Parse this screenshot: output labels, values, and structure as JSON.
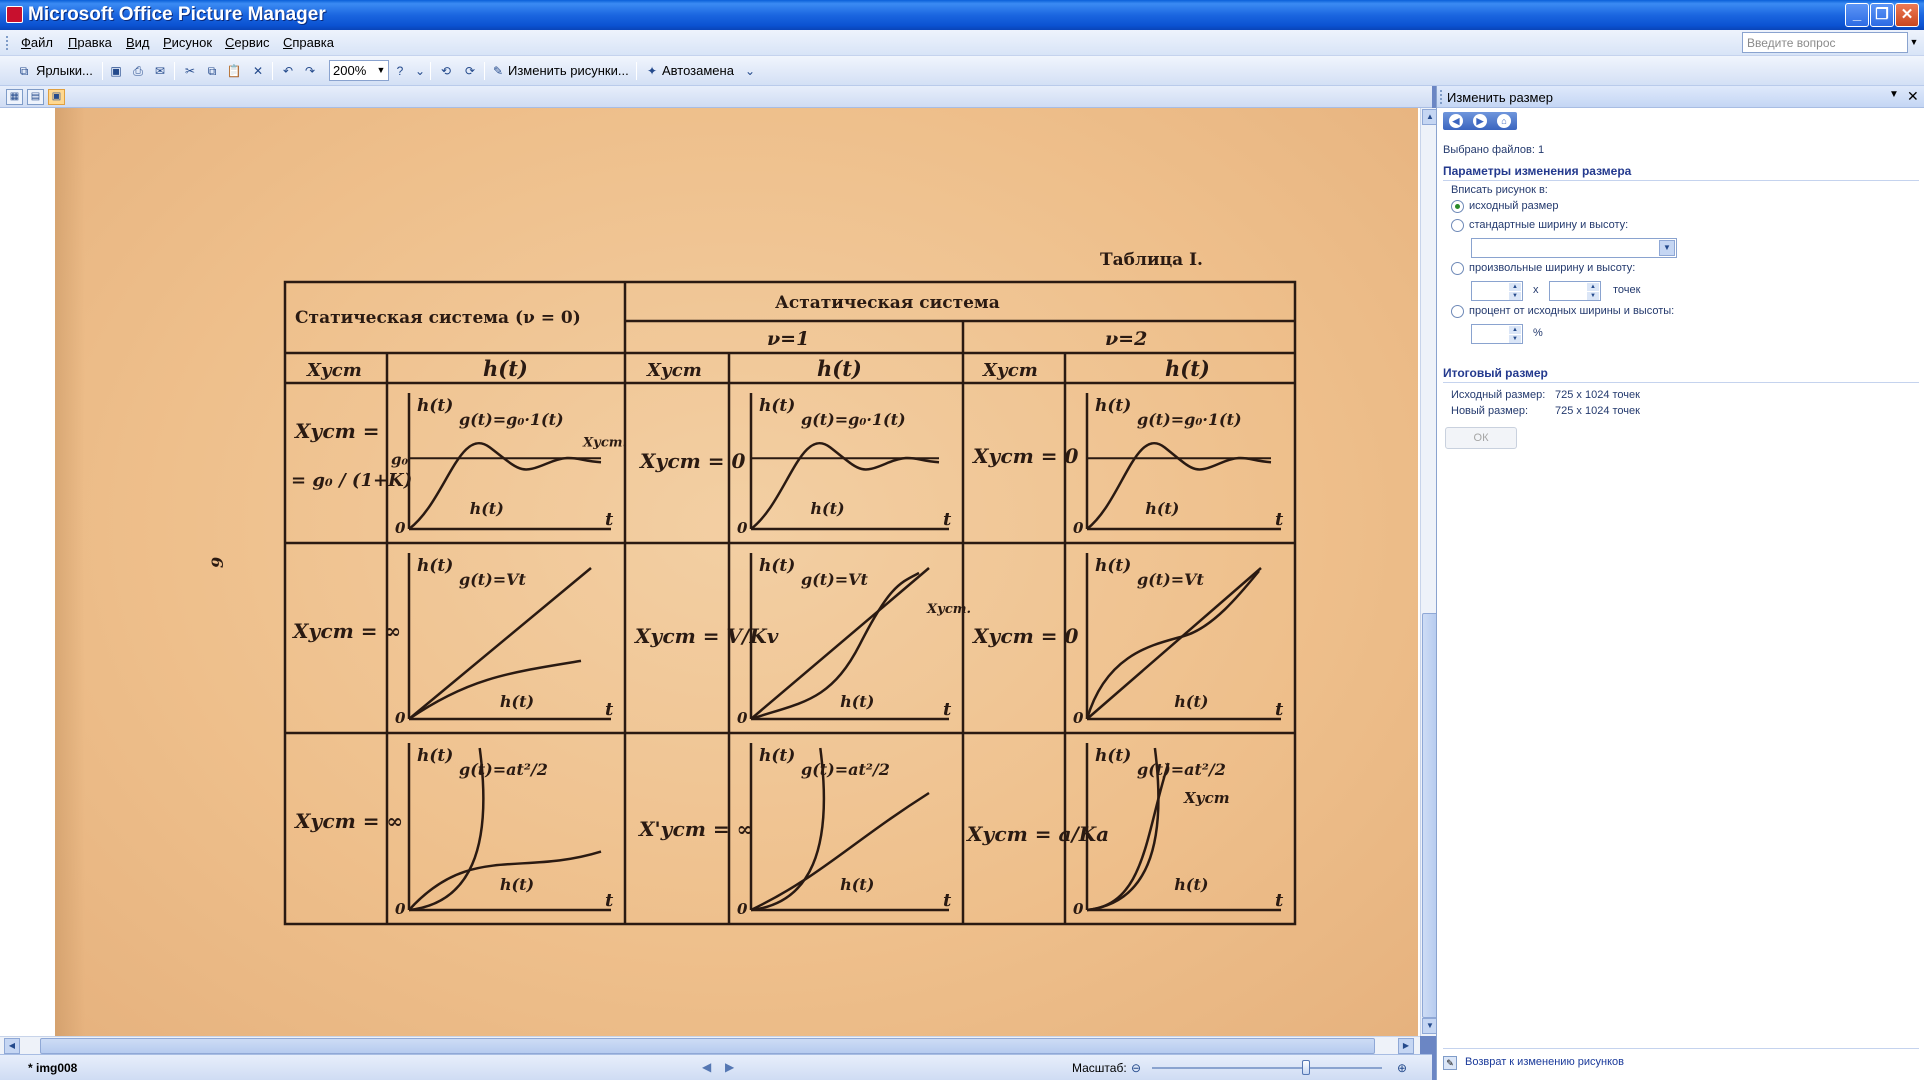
{
  "window": {
    "title": "Microsoft Office Picture Manager"
  },
  "menu": [
    "Файл",
    "Правка",
    "Вид",
    "Рисунок",
    "Сервис",
    "Справка"
  ],
  "ask_placeholder": "Введите вопрос",
  "toolbar": {
    "shortcuts": "Ярлыки...",
    "zoom": "200%",
    "edit_pictures": "Изменить рисунки...",
    "autocorrect": "Автозамена"
  },
  "document": {
    "table_label": "Таблица I.",
    "page_number": "9",
    "header_static": "Статическая система (ν = 0)",
    "header_astatic": "Астатическая система",
    "nu1": "ν=1",
    "nu2": "ν=2",
    "col_x": "Xуст",
    "col_h": "h(t)",
    "rows": [
      {
        "static_x": [
          "Xуст =",
          "= g₀ / (1+K)"
        ],
        "astatic1_x": "Xуст = 0",
        "astatic2_x": "Xуст = 0",
        "g_formula": "g(t)=g₀·1(t)"
      },
      {
        "static_x": [
          "Xуст = ∞"
        ],
        "astatic1_x": "Xуст = V/Kv",
        "astatic2_x": "Xуст = 0",
        "g_formula": "g(t)=Vt"
      },
      {
        "static_x": [
          "Xуст = ∞"
        ],
        "astatic1_x": "X'уст = ∞",
        "astatic2_x": "Xуст = a/Ka",
        "g_formula": "g(t)=at²/2"
      }
    ],
    "plot_labels": {
      "h": "h(t)",
      "t": "t",
      "zero": "0",
      "g0": "g₀",
      "xust": "Xуст.",
      "xust2": "Xуст"
    }
  },
  "statusbar": {
    "file": "* img008",
    "zoom_label": "Масштаб:"
  },
  "taskpane": {
    "title": "Изменить размер",
    "selected": "Выбрано файлов: 1",
    "section1": "Параметры изменения размера",
    "fit_label": "Вписать рисунок в:",
    "opt1": "исходный размер",
    "opt2": "стандартные ширину и высоту:",
    "opt3": "произвольные ширину и высоту:",
    "x_sep": "x",
    "points": "точек",
    "opt4": "процент от исходных ширины и высоты:",
    "percent": "%",
    "section2": "Итоговый размер",
    "orig_label": "Исходный размер:",
    "orig_value": "725 x 1024 точек",
    "new_label": "Новый размер:",
    "new_value": "725 x 1024 точек",
    "ok": "ОК",
    "back_link": "Возврат к изменению рисунков"
  }
}
